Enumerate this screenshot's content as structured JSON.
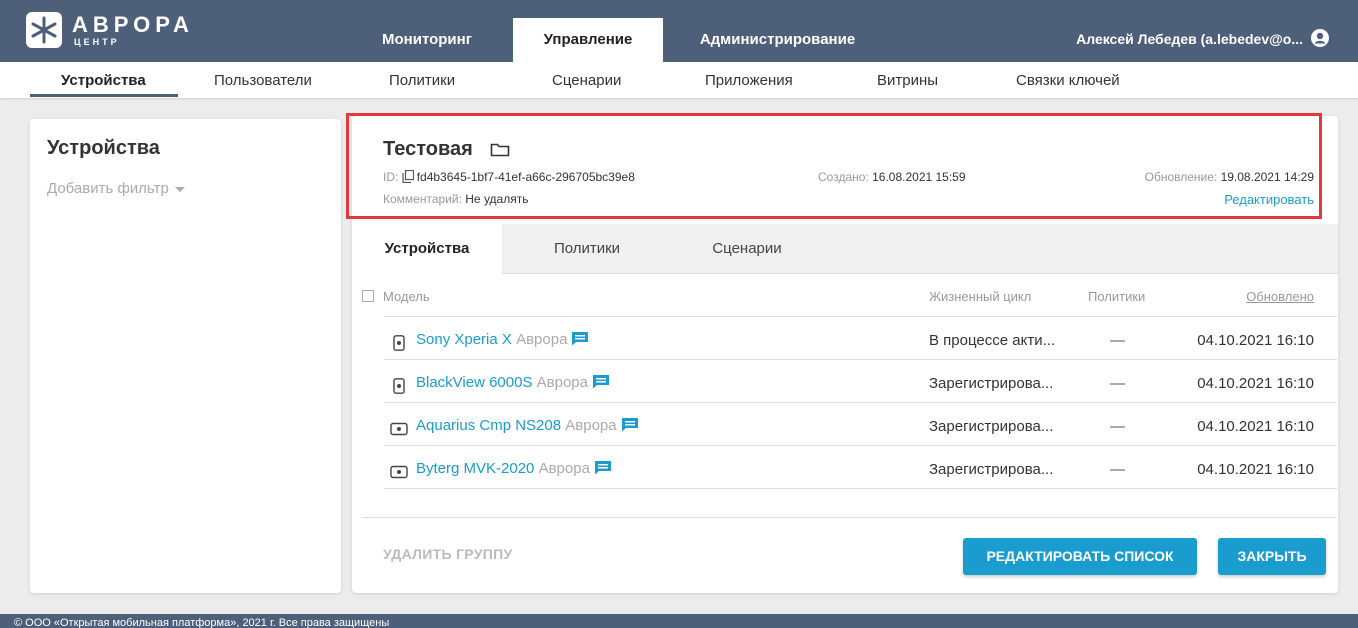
{
  "app": {
    "logo_name": "АВРОРА",
    "logo_sub": "ЦЕНТР",
    "user": "Алексей Лебедев (a.lebedev@o...",
    "accent": "#1a9ccf",
    "header_color": "#4e5f7a",
    "highlight_color": "#e5383b"
  },
  "main_tabs": [
    "Мониторинг",
    "Управление",
    "Администрирование"
  ],
  "sub_nav": [
    "Устройства",
    "Пользователи",
    "Политики",
    "Сценарии",
    "Приложения",
    "Витрины",
    "Связки ключей"
  ],
  "left": {
    "title": "Устройства",
    "filter": "Добавить фильтр"
  },
  "group": {
    "title": "Тестовая",
    "id_label": "ID:",
    "id_value": "fd4b3645-1bf7-41ef-a66c-296705bc39e8",
    "created_label": "Создано:",
    "created_value": "16.08.2021 15:59",
    "updated_label": "Обновление:",
    "updated_value": "19.08.2021 14:29",
    "comment_label": "Комментарий:",
    "comment_value": "Не удалять",
    "edit": "Редактировать"
  },
  "tabs": [
    "Устройства",
    "Политики",
    "Сценарии"
  ],
  "table": {
    "headers": {
      "model": "Модель",
      "lifecycle": "Жизненный цикл",
      "policies": "Политики",
      "updated": "Обновлено"
    },
    "rows": [
      {
        "name": "Sony Xperia X",
        "os": "Аврора",
        "type": "phone",
        "lifecycle": "В процессе акти...",
        "policies": "—",
        "updated": "04.10.2021 16:10"
      },
      {
        "name": "BlackView 6000S",
        "os": "Аврора",
        "type": "phone",
        "lifecycle": "Зарегистрирова...",
        "policies": "—",
        "updated": "04.10.2021 16:10"
      },
      {
        "name": "Aquarius Cmp NS208",
        "os": "Аврора",
        "type": "tablet",
        "lifecycle": "Зарегистрирова...",
        "policies": "—",
        "updated": "04.10.2021 16:10"
      },
      {
        "name": "Byterg MVK-2020",
        "os": "Аврора",
        "type": "tablet",
        "lifecycle": "Зарегистрирова...",
        "policies": "—",
        "updated": "04.10.2021 16:10"
      }
    ]
  },
  "actions": {
    "delete_group": "УДАЛИТЬ ГРУППУ",
    "edit_list": "РЕДАКТИРОВАТЬ СПИСОК",
    "close": "ЗАКРЫТЬ"
  },
  "footer": "© ООО «Открытая мобильная платформа», 2021 г. Все права защищены"
}
